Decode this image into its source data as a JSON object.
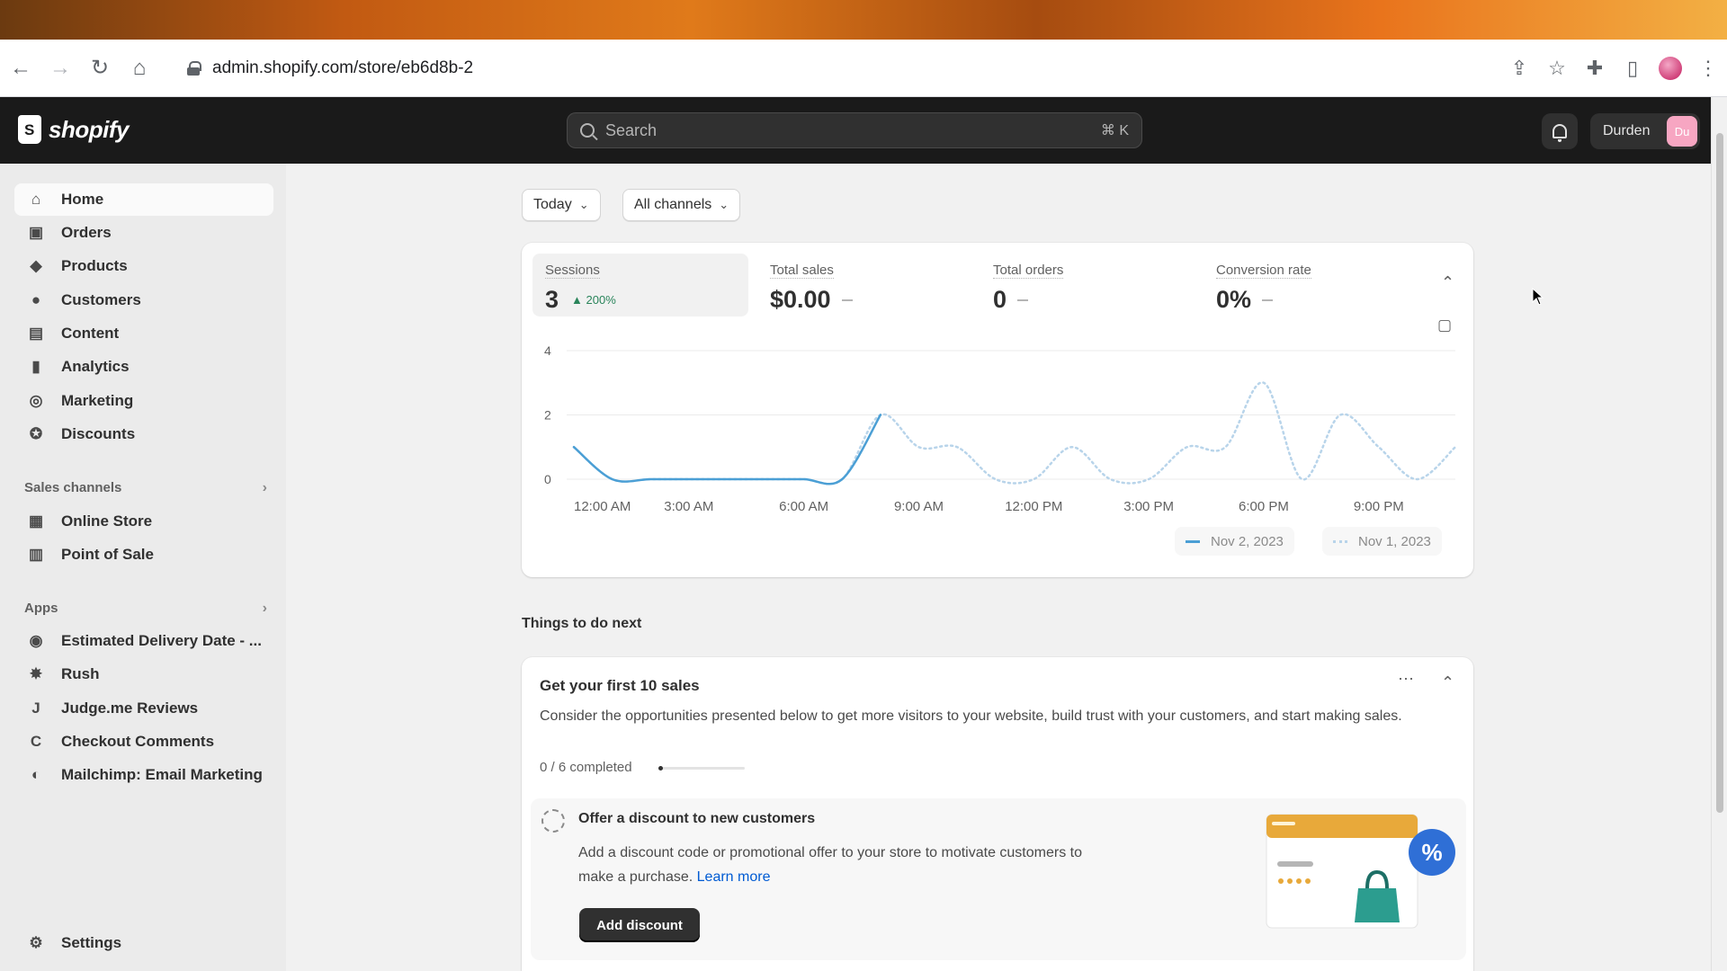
{
  "browser": {
    "url": "admin.shopify.com/store/eb6d8b-2",
    "nav": {
      "back": "←",
      "forward": "→",
      "reload": "↻",
      "home": "⌂"
    },
    "actions": {
      "share": "⇪",
      "bookmark": "☆",
      "extensions": "✚",
      "sidepanel": "▯",
      "menu": "⋮"
    }
  },
  "header": {
    "brand": "shopify",
    "search_placeholder": "Search",
    "search_shortcut": "⌘ K",
    "user_name": "Durden",
    "user_initials": "Du"
  },
  "sidebar": {
    "items": [
      {
        "label": "Home",
        "icon": "home-icon",
        "glyph": "⌂"
      },
      {
        "label": "Orders",
        "icon": "inbox-icon",
        "glyph": "▣"
      },
      {
        "label": "Products",
        "icon": "tag-icon",
        "glyph": "◆"
      },
      {
        "label": "Customers",
        "icon": "person-icon",
        "glyph": "●"
      },
      {
        "label": "Content",
        "icon": "content-icon",
        "glyph": "▤"
      },
      {
        "label": "Analytics",
        "icon": "bar-chart-icon",
        "glyph": "▮"
      },
      {
        "label": "Marketing",
        "icon": "target-icon",
        "glyph": "◎"
      },
      {
        "label": "Discounts",
        "icon": "discount-icon",
        "glyph": "✪"
      }
    ],
    "sales_channels_label": "Sales channels",
    "sales_channels": [
      {
        "label": "Online Store",
        "icon": "store-icon",
        "glyph": "▦"
      },
      {
        "label": "Point of Sale",
        "icon": "pos-icon",
        "glyph": "▥"
      }
    ],
    "apps_label": "Apps",
    "apps": [
      {
        "label": "Estimated Delivery Date - ...",
        "icon": "delivery-app-icon",
        "glyph": "◉"
      },
      {
        "label": "Rush",
        "icon": "rush-app-icon",
        "glyph": "✸"
      },
      {
        "label": "Judge.me Reviews",
        "icon": "judgeme-app-icon",
        "glyph": "J"
      },
      {
        "label": "Checkout Comments",
        "icon": "comments-app-icon",
        "glyph": "C"
      },
      {
        "label": "Mailchimp: Email Marketing",
        "icon": "mailchimp-app-icon",
        "glyph": "◐"
      }
    ],
    "settings_label": "Settings"
  },
  "filters": {
    "date": "Today",
    "channel": "All channels"
  },
  "metrics": [
    {
      "label": "Sessions",
      "value": "3",
      "change": "▲ 200%"
    },
    {
      "label": "Total sales",
      "value": "$0.00",
      "change": ""
    },
    {
      "label": "Total orders",
      "value": "0",
      "change": ""
    },
    {
      "label": "Conversion rate",
      "value": "0%",
      "change": ""
    }
  ],
  "chart_data": {
    "type": "line",
    "x_tick_labels": [
      "12:00 AM",
      "3:00 AM",
      "6:00 AM",
      "9:00 AM",
      "12:00 PM",
      "3:00 PM",
      "6:00 PM",
      "9:00 PM"
    ],
    "x_hours": [
      0,
      1,
      2,
      3,
      4,
      5,
      6,
      7,
      8,
      9,
      10,
      11,
      12,
      13,
      14,
      15,
      16,
      17,
      18,
      19,
      20,
      21,
      22,
      23
    ],
    "y_ticks": [
      0,
      2,
      4
    ],
    "ylim": [
      0,
      4
    ],
    "series": [
      {
        "name": "Nov 2, 2023",
        "style": "solid",
        "color": "#4b9fd5",
        "values": [
          1,
          0,
          0,
          0,
          0,
          0,
          0,
          0,
          2
        ]
      },
      {
        "name": "Nov 1, 2023",
        "style": "dotted",
        "color": "#b8d4ea",
        "values": [
          1,
          0,
          0,
          0,
          0,
          0,
          0,
          0,
          2,
          1,
          1,
          0,
          0,
          1,
          0,
          0,
          1,
          1,
          3,
          0,
          2,
          1,
          0,
          1
        ]
      }
    ],
    "grid": true,
    "legend_position": "bottom-right"
  },
  "todo": {
    "section_title": "Things to do next",
    "card_title": "Get your first 10 sales",
    "card_description": "Consider the opportunities presented below to get more visitors to your website, build trust with your customers, and start making sales.",
    "progress_label": "0 / 6 completed",
    "progress_fraction": 0.05,
    "task": {
      "title": "Offer a discount to new customers",
      "description": "Add a discount code or promotional offer to your store to motivate customers to make a purchase.",
      "link": "Learn more",
      "button": "Add discount"
    }
  }
}
